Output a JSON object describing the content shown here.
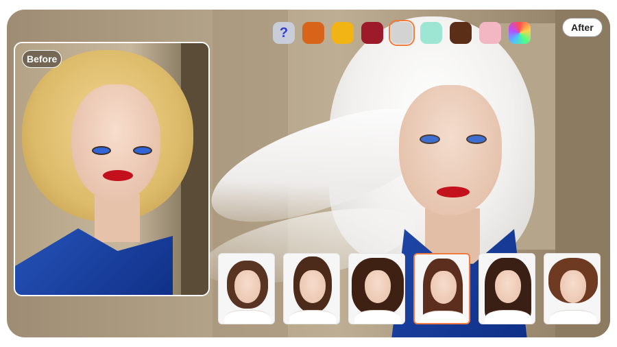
{
  "swatches": [
    {
      "name": "unknown",
      "label": "?",
      "color": "#c9ccd9"
    },
    {
      "name": "copper",
      "color": "#d8641a"
    },
    {
      "name": "golden",
      "color": "#f2b315"
    },
    {
      "name": "burgundy",
      "color": "#9c1a2a"
    },
    {
      "name": "silver",
      "color": "#d3d3d3",
      "selected": true
    },
    {
      "name": "mint",
      "color": "#9ee6d4"
    },
    {
      "name": "chocolate",
      "color": "#5a2e17"
    },
    {
      "name": "pink",
      "color": "#f2b7c3"
    },
    {
      "name": "rainbow",
      "color": "conic-gradient(#ff4d4d,#ffd24d,#4dff88,#4dc3ff,#b84dff,#ff4d4d)"
    }
  ],
  "labels": {
    "before": "Before",
    "after": "After"
  },
  "styles": [
    {
      "name": "bob",
      "hair": "#5a3422"
    },
    {
      "name": "updo-bangs",
      "hair": "#4c2b1b"
    },
    {
      "name": "curly",
      "hair": "#3f2114"
    },
    {
      "name": "long-straight",
      "hair": "#5b2e1d",
      "selected": true
    },
    {
      "name": "braids",
      "hair": "#3a1f14"
    },
    {
      "name": "double-bun",
      "hair": "#6e3a22"
    }
  ],
  "accent": "#f07a3c"
}
